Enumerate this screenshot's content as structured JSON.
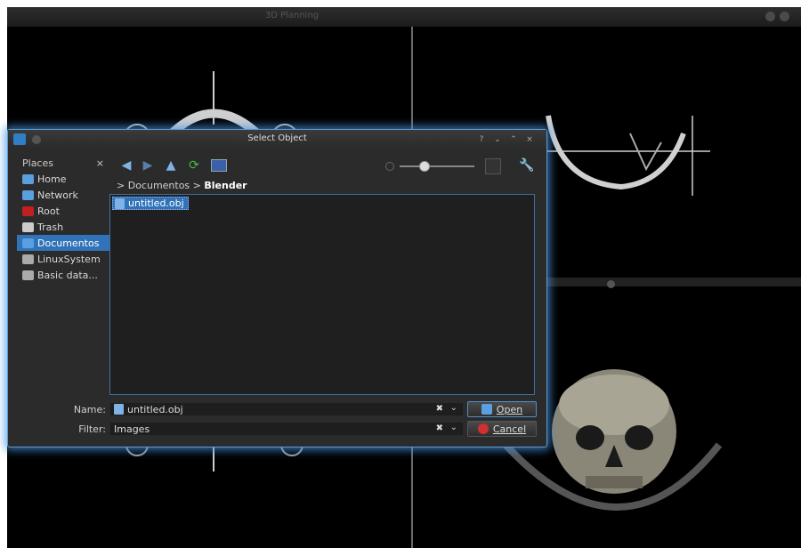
{
  "app": {
    "title": "3D Planning"
  },
  "dialog": {
    "title": "Select Object",
    "title_buttons": [
      "?",
      "⌄",
      "⌃",
      "×"
    ],
    "places": {
      "header": "Places",
      "close": "×",
      "items": [
        {
          "label": "Home",
          "icon": "home-folder-icon",
          "color": "#5aa0e0"
        },
        {
          "label": "Network",
          "icon": "network-icon",
          "color": "#5aa0e0"
        },
        {
          "label": "Root",
          "icon": "root-folder-icon",
          "color": "#c02020"
        },
        {
          "label": "Trash",
          "icon": "trash-icon",
          "color": "#cccccc"
        },
        {
          "label": "Documentos",
          "icon": "documents-folder-icon",
          "color": "#5aa0e0",
          "selected": true
        },
        {
          "label": "LinuxSystem",
          "icon": "drive-icon",
          "color": "#aaaaaa"
        },
        {
          "label": "Basic data...",
          "icon": "drive-icon",
          "color": "#aaaaaa"
        }
      ]
    },
    "breadcrumb": {
      "sep": ">",
      "parent": "Documentos",
      "current": "Blender"
    },
    "files": [
      "untitled.obj"
    ],
    "name_label": "Name:",
    "name_value": "untitled.obj",
    "filter_label": "Filter:",
    "filter_value": "Images",
    "open_label": "Open",
    "cancel_label": "Cancel",
    "icons": {
      "clear": "clear-text-icon",
      "dropdown": "chevron-down-icon"
    },
    "colors": {
      "accent": "#3073b8",
      "glow": "#4696e6"
    }
  }
}
